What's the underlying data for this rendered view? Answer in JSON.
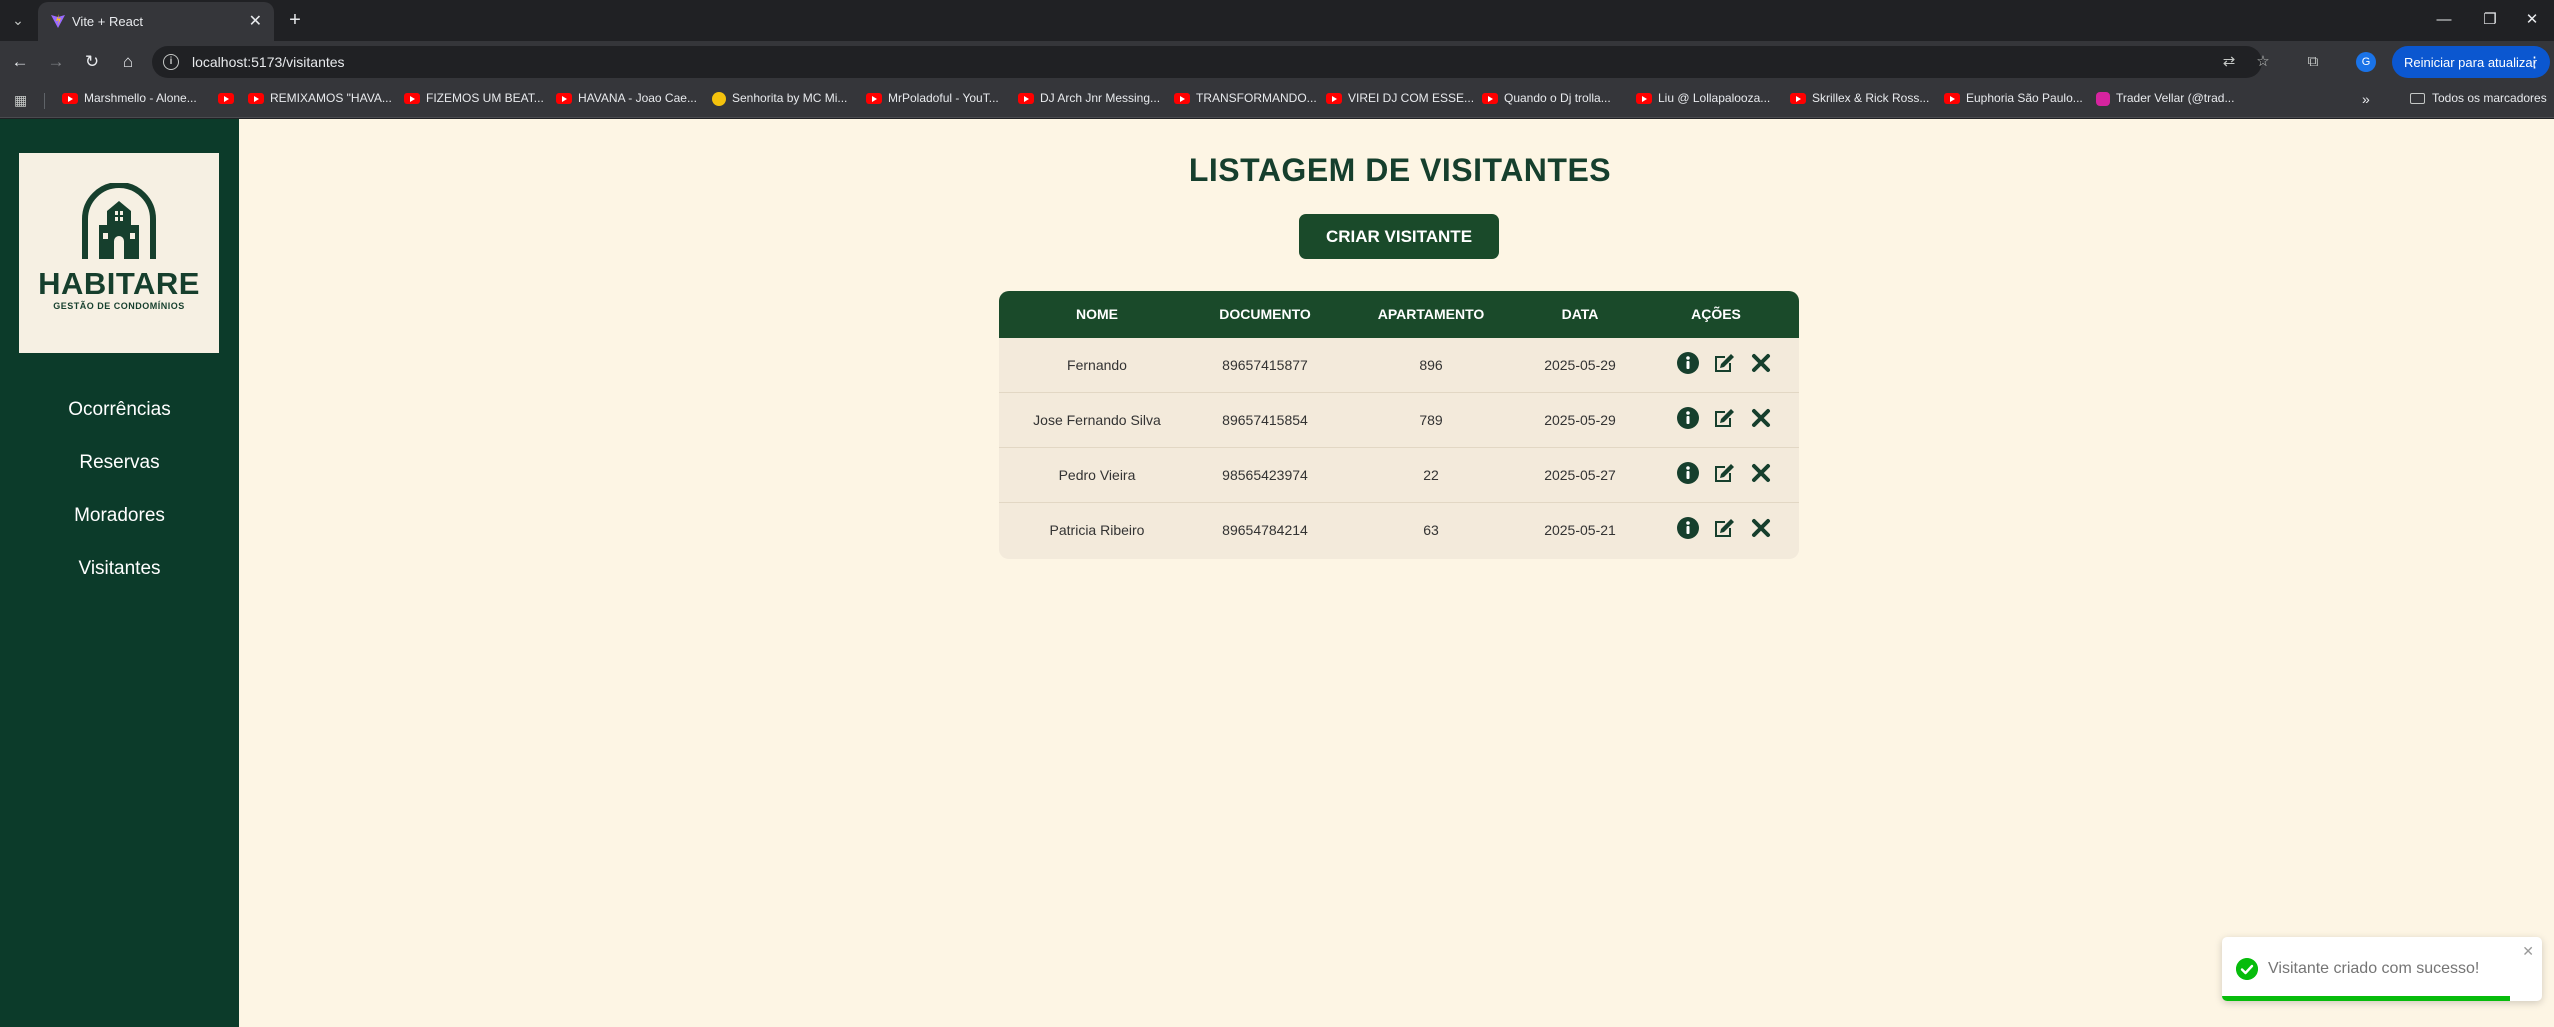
{
  "browser": {
    "tab_title": "Vite + React",
    "url": "localhost:5173/visitantes",
    "update_button": "Reiniciar para atualizar",
    "profile_initial": "G",
    "bookmarks": [
      "Marshmello - Alone...",
      "REMIXAMOS \"HAVA...",
      "FIZEMOS UM BEAT...",
      "HAVANA - Joao Cae...",
      "Senhorita by MC Mi...",
      "MrPoladoful - YouT...",
      "DJ Arch Jnr Messing...",
      "TRANSFORMANDO...",
      "VIREI DJ COM ESSE...",
      "Quando o Dj trolla...",
      "Liu @ Lollapalooza...",
      "Skrillex & Rick Ross...",
      "Euphoria São Paulo...",
      "Trader Vellar (@trad..."
    ],
    "bookmarks_folder": "Todos os marcadores"
  },
  "sidebar": {
    "logo_title": "HABITARE",
    "logo_subtitle": "GESTÃO DE CONDOMÍNIOS",
    "items": [
      {
        "label": "Ocorrências"
      },
      {
        "label": "Reservas"
      },
      {
        "label": "Moradores"
      },
      {
        "label": "Visitantes"
      }
    ]
  },
  "main": {
    "title": "LISTAGEM DE VISITANTES",
    "create_button": "CRIAR VISITANTE",
    "table": {
      "headers": [
        "NOME",
        "DOCUMENTO",
        "APARTAMENTO",
        "DATA",
        "AÇÕES"
      ],
      "rows": [
        {
          "nome": "Fernando",
          "documento": "89657415877",
          "apartamento": "896",
          "data": "2025-05-29"
        },
        {
          "nome": "Jose Fernando Silva",
          "documento": "89657415854",
          "apartamento": "789",
          "data": "2025-05-29"
        },
        {
          "nome": "Pedro Vieira",
          "documento": "98565423974",
          "apartamento": "22",
          "data": "2025-05-27"
        },
        {
          "nome": "Patricia Ribeiro",
          "documento": "89654784214",
          "apartamento": "63",
          "data": "2025-05-21"
        }
      ]
    }
  },
  "toast": {
    "message": "Visitante criado com sucesso!",
    "progress": 0.9
  },
  "colors": {
    "sidebar": "#0c3b2a",
    "accent": "#1a4a2a",
    "background": "#fdf5e4",
    "success": "#07bc0c"
  }
}
